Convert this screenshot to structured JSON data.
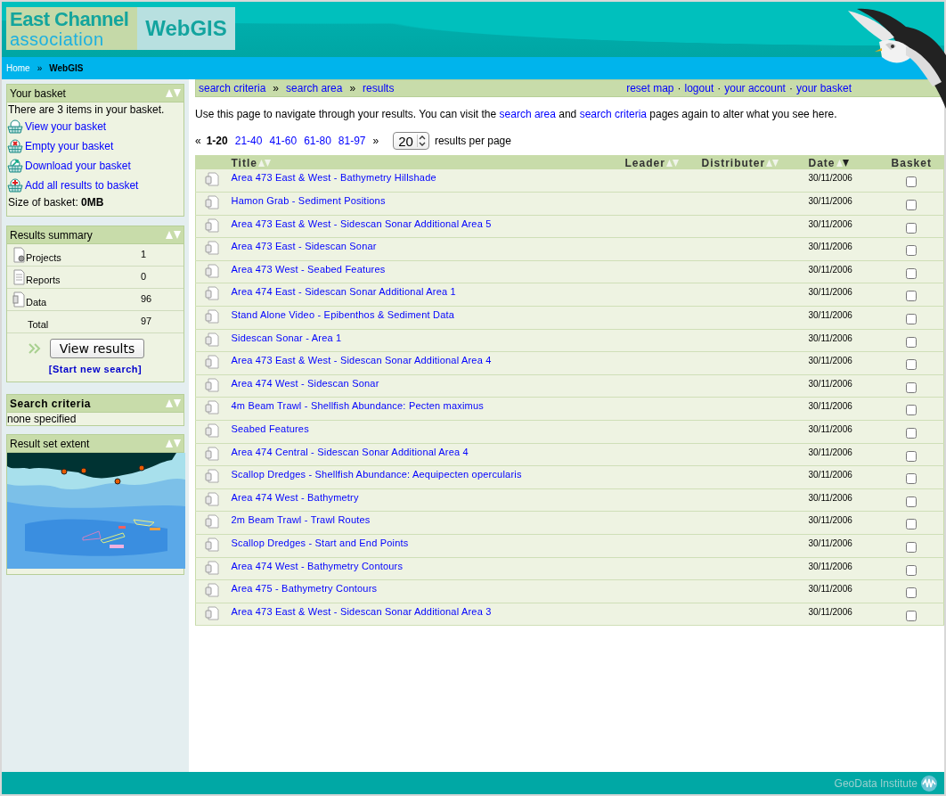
{
  "header": {
    "logo_line1": "East Channel",
    "logo_line2": "association",
    "logo_product": "WebGIS"
  },
  "breadcrumb": {
    "separator": "»",
    "items": [
      {
        "label": "Home",
        "current": false
      },
      {
        "label": "WebGIS",
        "current": true
      }
    ]
  },
  "sidebar": {
    "basket": {
      "title": "Your basket",
      "message": "There are 3 items in your basket.",
      "actions": [
        {
          "kind": "view",
          "label": "View your basket"
        },
        {
          "kind": "empty",
          "label": "Empty your basket"
        },
        {
          "kind": "download",
          "label": "Download your basket"
        },
        {
          "kind": "add",
          "label": "Add all results to basket"
        }
      ],
      "size_label": "Size of basket:",
      "size_value": "0MB"
    },
    "results_summary": {
      "title": "Results summary",
      "rows": [
        {
          "kind": "project",
          "label": "Projects",
          "count": "1"
        },
        {
          "kind": "report",
          "label": "Reports",
          "count": "0"
        },
        {
          "kind": "data",
          "label": "Data",
          "count": "96"
        },
        {
          "kind": "total",
          "label": "Total",
          "count": "97"
        }
      ],
      "button": "View results",
      "link": "[Start new search]"
    },
    "search_criteria": {
      "title": "Search criteria",
      "text": "none specified"
    },
    "result_extent": {
      "title": "Result set extent"
    }
  },
  "topnav": {
    "separator": "»",
    "steps": [
      "search criteria",
      "search area",
      "results"
    ],
    "link_separator": "·",
    "links": [
      "reset map",
      "logout",
      "your account",
      "your basket"
    ]
  },
  "intro": {
    "text_1": "Use this page to navigate through your results. You can visit the ",
    "link_1": "search area",
    "text_2": " and ",
    "link_2": "search criteria",
    "text_3": " pages again to alter what you see here."
  },
  "pagination": {
    "prev": "«",
    "next": "»",
    "pages": [
      {
        "label": "1-20",
        "selected": true
      },
      {
        "label": "21-40",
        "selected": false
      },
      {
        "label": "41-60",
        "selected": false
      },
      {
        "label": "61-80",
        "selected": false
      },
      {
        "label": "81-97",
        "selected": false
      }
    ],
    "per_page": "20",
    "per_page_label": "results per page"
  },
  "table": {
    "columns": [
      {
        "label": "Title",
        "sortable": true,
        "sorted": false
      },
      {
        "label": "Leader",
        "sortable": true,
        "sorted": false
      },
      {
        "label": "Distributer",
        "sortable": true,
        "sorted": false
      },
      {
        "label": "Date",
        "sortable": true,
        "sorted": true
      },
      {
        "label": "Basket"
      }
    ],
    "rows": [
      {
        "title": "Area 473 East & West - Bathymetry Hillshade",
        "date": "30/11/2006",
        "checked": false
      },
      {
        "title": "Hamon Grab - Sediment Positions",
        "date": "30/11/2006",
        "checked": false
      },
      {
        "title": "Area 473 East & West - Sidescan Sonar Additional Area 5",
        "date": "30/11/2006",
        "checked": false
      },
      {
        "title": "Area 473 East - Sidescan Sonar",
        "date": "30/11/2006",
        "checked": false
      },
      {
        "title": "Area 473 West - Seabed Features",
        "date": "30/11/2006",
        "checked": false
      },
      {
        "title": "Area 474 East - Sidescan Sonar Additional Area 1",
        "date": "30/11/2006",
        "checked": false
      },
      {
        "title": "Stand Alone Video - Epibenthos & Sediment Data",
        "date": "30/11/2006",
        "checked": false
      },
      {
        "title": "Sidescan Sonar - Area 1",
        "date": "30/11/2006",
        "checked": false
      },
      {
        "title": "Area 473 East & West - Sidescan Sonar Additional Area 4",
        "date": "30/11/2006",
        "checked": false
      },
      {
        "title": "Area 474 West - Sidescan Sonar",
        "date": "30/11/2006",
        "checked": false
      },
      {
        "title": "4m Beam Trawl - Shellfish Abundance: Pecten maximus",
        "date": "30/11/2006",
        "checked": false
      },
      {
        "title": "Seabed Features",
        "date": "30/11/2006",
        "checked": false
      },
      {
        "title": "Area 474 Central - Sidescan Sonar Additional Area 4",
        "date": "30/11/2006",
        "checked": false
      },
      {
        "title": "Scallop Dredges - Shellfish Abundance: Aequipecten opercularis",
        "date": "30/11/2006",
        "checked": false
      },
      {
        "title": "Area 474 West - Bathymetry",
        "date": "30/11/2006",
        "checked": false
      },
      {
        "title": "2m Beam Trawl - Trawl Routes",
        "date": "30/11/2006",
        "checked": false
      },
      {
        "title": "Scallop Dredges - Start and End Points",
        "date": "30/11/2006",
        "checked": false
      },
      {
        "title": "Area 474 West - Bathymetry Contours",
        "date": "30/11/2006",
        "checked": false
      },
      {
        "title": "Area 475 - Bathymetry Contours",
        "date": "30/11/2006",
        "checked": false
      },
      {
        "title": "Area 473 East & West - Sidescan Sonar Additional Area 3",
        "date": "30/11/2006",
        "checked": false
      }
    ]
  },
  "footer": {
    "text": "GeoData Institute"
  }
}
